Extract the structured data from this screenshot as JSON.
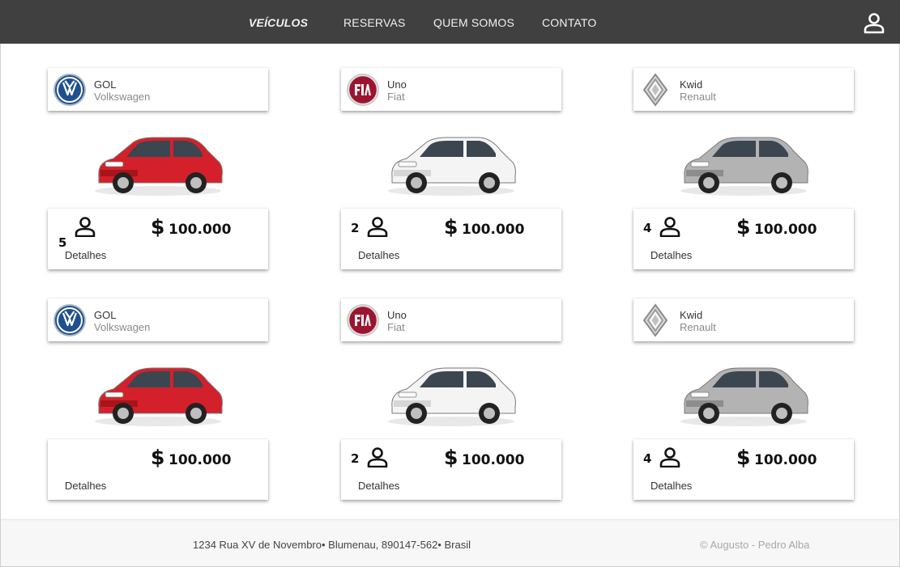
{
  "nav": {
    "items": [
      {
        "label": "VEÍCULOS",
        "active": true
      },
      {
        "label": "RESERVAS",
        "active": false
      },
      {
        "label": "QUEM SOMOS",
        "active": false
      },
      {
        "label": "CONTATO",
        "active": false
      }
    ],
    "profile_icon": "user-icon"
  },
  "vehicles": [
    {
      "model": "GOL",
      "brand": "Volkswagen",
      "logo": "volkswagen-logo",
      "color": "#d4202a",
      "seats": "5",
      "currency": "$",
      "price": "100.000",
      "details": "Detalhes"
    },
    {
      "model": "Uno",
      "brand": "Fiat",
      "logo": "fiat-logo",
      "color": "#f4f4f4",
      "seats": "2",
      "currency": "$",
      "price": "100.000",
      "details": "Detalhes"
    },
    {
      "model": "Kwid",
      "brand": "Renault",
      "logo": "renault-logo",
      "color": "#b3b3b3",
      "seats": "4",
      "currency": "$",
      "price": "100.000",
      "details": "Detalhes"
    },
    {
      "model": "GOL",
      "brand": "Volkswagen",
      "logo": "volkswagen-logo",
      "color": "#d4202a",
      "seats": "",
      "currency": "$",
      "price": "100.000",
      "details": "Detalhes"
    },
    {
      "model": "Uno",
      "brand": "Fiat",
      "logo": "fiat-logo",
      "color": "#f4f4f4",
      "seats": "2",
      "currency": "$",
      "price": "100.000",
      "details": "Detalhes"
    },
    {
      "model": "Kwid",
      "brand": "Renault",
      "logo": "renault-logo",
      "color": "#b3b3b3",
      "seats": "4",
      "currency": "$",
      "price": "100.000",
      "details": "Detalhes"
    }
  ],
  "footer": {
    "address": "1234 Rua XV de Novembro• Blumenau, 890147-562• Brasil",
    "copyright": "© Augusto - Pedro Alba"
  }
}
